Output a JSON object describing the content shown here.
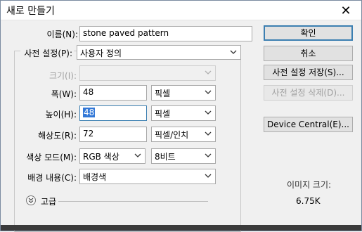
{
  "window": {
    "title": "새로 만들기"
  },
  "form": {
    "name_label": "이름(N):",
    "name_value": "stone paved pattern",
    "preset_label": "사전 설정(P):",
    "preset_value": "사용자 정의",
    "size_label": "크기(I):",
    "width_label": "폭(W):",
    "width_value": "48",
    "width_unit": "픽셀",
    "height_label": "높이(H):",
    "height_value": "48",
    "height_unit": "픽셀",
    "resolution_label": "해상도(R):",
    "resolution_value": "72",
    "resolution_unit": "픽셀/인치",
    "color_mode_label": "색상 모드(M):",
    "color_mode_value": "RGB 색상",
    "bit_depth_value": "8비트",
    "background_label": "배경 내용(C):",
    "background_value": "배경색",
    "advanced_label": "고급"
  },
  "buttons": {
    "ok": "확인",
    "cancel": "취소",
    "save_preset": "사전 설정 저장(S)...",
    "delete_preset": "사전 설정 삭제(D)...",
    "device_central": "Device Central(E)..."
  },
  "info": {
    "image_size_label": "이미지 크기:",
    "image_size_value": "6.75K"
  },
  "icons": {
    "close": "close-icon",
    "dropdown": "chevron-down-icon",
    "advanced": "double-chevron-down-icon"
  }
}
